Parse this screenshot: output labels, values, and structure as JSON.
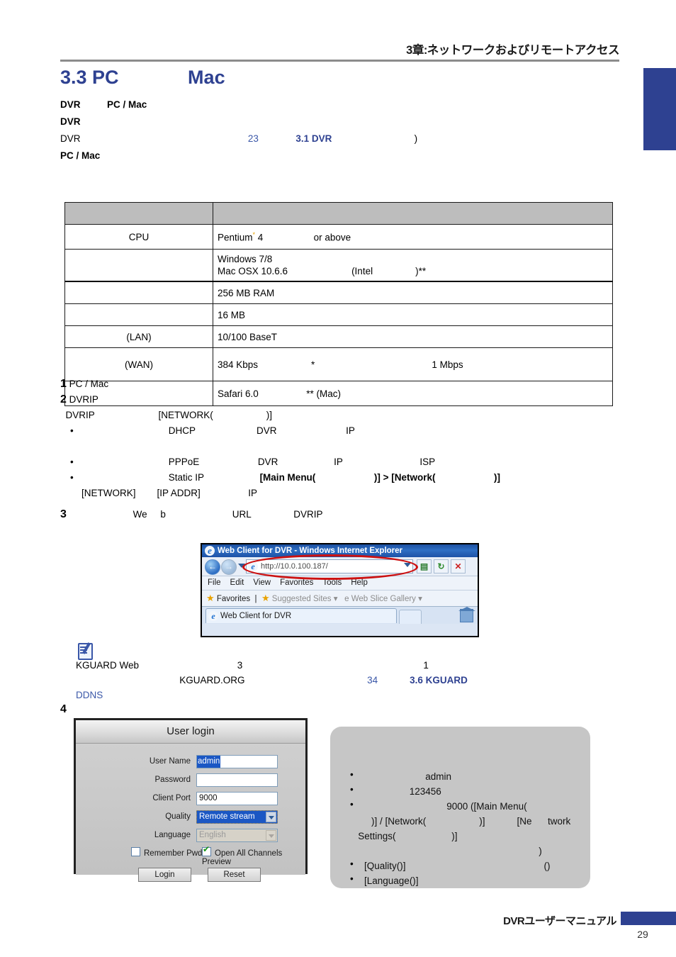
{
  "header": {
    "chapter_title": "3章:ネットワークおよびリモートアクセス"
  },
  "section": {
    "title": "3.3 PC             Mac"
  },
  "intro": {
    "line1_a": "DVR",
    "line1_b": "PC / Mac",
    "line2": "DVR",
    "line3_a": "DVR",
    "line3_link_page": "23",
    "line3_link_sec": "3.1 DVR",
    "line3_tail": ")",
    "line4": "PC / Mac"
  },
  "spec_table": {
    "header": {
      "col1": "",
      "col2": ""
    },
    "rows": [
      {
        "label": "CPU",
        "value": "Pentium",
        "value_sup": "*",
        "value_tail": " 4                   or above"
      },
      {
        "label": "",
        "value": "Windows 7/8\nMac OSX 10.6.6                        (Intel                )**"
      },
      {
        "label": "",
        "value": "256 MB RAM"
      },
      {
        "label": "",
        "value": "16 MB"
      },
      {
        "label": "(LAN)",
        "value": "10/100 BaseT"
      },
      {
        "label": "(WAN)",
        "value": "384 Kbps                    *                                            1 Mbps"
      },
      {
        "label": "",
        "value": "Safari 6.0                  ** (Mac)"
      }
    ]
  },
  "steps": {
    "s1_num": "1",
    "s1_text": "PC / Mac",
    "s2_num": "2",
    "s2_text": "DVRIP",
    "s2_sub": "DVRIP                        [NETWORK(                    )]",
    "s2_b1": "                             DHCP                       DVR                          IP",
    "s2_b2": "                             PPPoE                      DVR                     IP                             ISP",
    "s2_b3_pre": "                             Static IP                     ",
    "s2_b3_bold1": "[Main Menu(",
    "s2_b3_mid": "                      )] > ",
    "s2_b3_bold2": "[Network(",
    "s2_b3_tail": "                      )]",
    "s2_b3_line2": "        [NETWORK]        [IP ADDR]                  IP",
    "s3_num": "3",
    "s3_text": "                         We     b                         URL                DVRIP"
  },
  "browser": {
    "window_title": "Web Client for DVR - Windows Internet Explorer",
    "url": "http://10.0.100.187/",
    "menu": [
      "File",
      "Edit",
      "View",
      "Favorites",
      "Tools",
      "Help"
    ],
    "favorites_label": "Favorites",
    "suggested_sites": "Suggested Sites",
    "web_slice": "Web Slice Gallery",
    "tab_label": "Web Client for DVR",
    "ie_glyph": "e",
    "nav_back_icon": "back-arrow",
    "nav_forward_icon": "forward-arrow",
    "stop_icon": "✕",
    "refresh_icon": "↻",
    "feeds_icon": "▤"
  },
  "note": {
    "line1": "KGUARD Web                                     3                                                                    1",
    "line2_pre": "                                       KGUARD.ORG                                              ",
    "line2_link_page": "34",
    "line2_link_sec": "3.6 KGUARD",
    "line3_link": "DDNS"
  },
  "step4": {
    "num": "4"
  },
  "login_dialog": {
    "title": "User login",
    "fields": [
      {
        "label": "User Name",
        "value": "admin",
        "type": "text",
        "selected": true
      },
      {
        "label": "Password",
        "value": "",
        "type": "text",
        "selected": false
      },
      {
        "label": "Client Port",
        "value": "9000",
        "type": "text",
        "selected": false
      },
      {
        "label": "Quality",
        "value": "Remote stream",
        "type": "select",
        "state": "active"
      },
      {
        "label": "Language",
        "value": "English",
        "type": "select",
        "state": "disabled"
      }
    ],
    "checkbox_remember": {
      "label": "Remember Pwd",
      "checked": false
    },
    "checkbox_preview": {
      "label": "Open All Channels Preview",
      "checked": true
    },
    "login_button": "Login",
    "reset_button": "Reset"
  },
  "callout": {
    "items": [
      {
        "text": "                       admin"
      },
      {
        "text": "                 123456"
      },
      {
        "text": "                               9000 ([Main Menu("
      }
    ],
    "line4": "        )] / [Network(                    )]            [Ne      twork",
    "line5": "   Settings(                     )]",
    "line6": "                                                                       )",
    "item4": "[Quality()]                                                    ()",
    "item5": "[Language()]"
  },
  "footer": {
    "manual_title": "DVRユーザーマニュアル",
    "page_number": "29"
  },
  "colors": {
    "brand_blue": "#2e4191",
    "link_blue": "#3a57a8",
    "table_header_gray": "#bdbdbd",
    "callout_gray": "#c6c6c6"
  }
}
